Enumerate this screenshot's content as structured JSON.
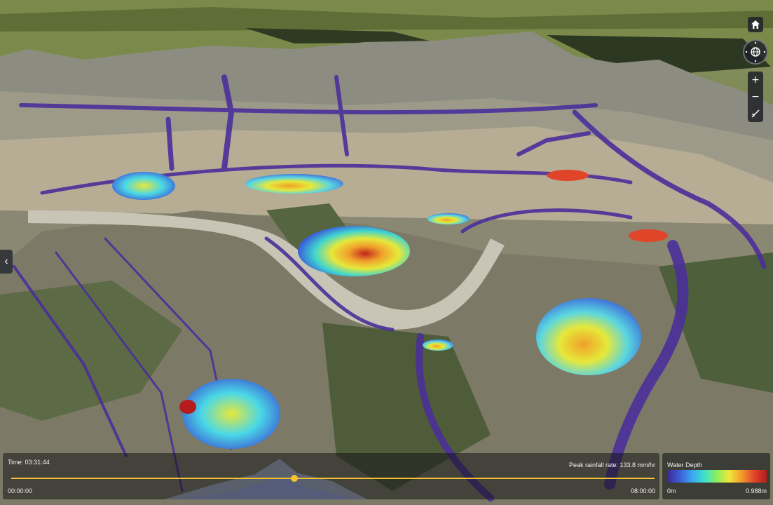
{
  "timeline": {
    "time_label": "Time: 03:31:44",
    "peak_rainfall": "Peak rainfall rate: 133.8 mm/hr",
    "start_time": "00:00:00",
    "end_time": "08:00:00",
    "progress": 0.44
  },
  "legend": {
    "title": "Water Depth",
    "min_label": "0m",
    "max_label": "0.988m",
    "colors": [
      "#3b2a8f",
      "#3f5bd8",
      "#3aa6f0",
      "#3fe0d0",
      "#8cf05a",
      "#f0e53a",
      "#f59a2a",
      "#e0452a",
      "#b51d1d"
    ]
  },
  "controls": {
    "home_icon": "home-icon",
    "compass_icon": "globe-compass-icon",
    "zoom_in_label": "+",
    "zoom_out_label": "−",
    "sidebar_toggle_label": "‹"
  },
  "accent_color": "#f2c230"
}
